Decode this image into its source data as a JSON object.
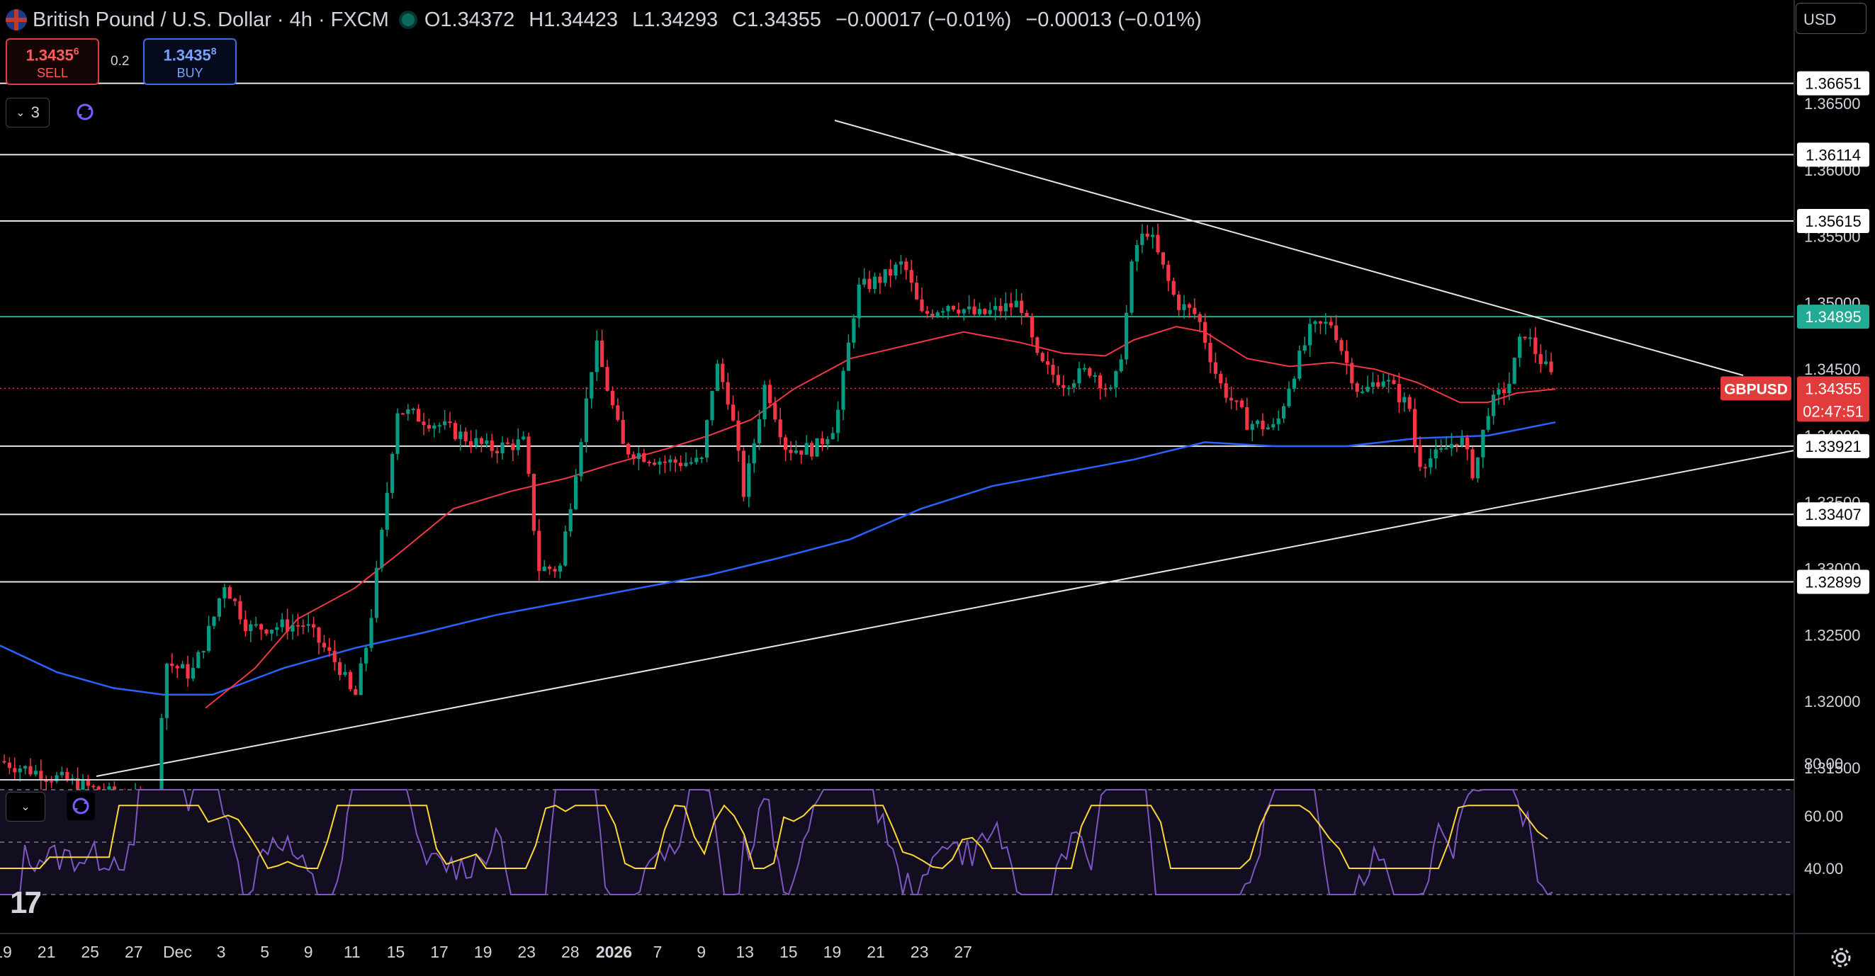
{
  "header": {
    "title": "British Pound / U.S. Dollar · 4h · FXCM",
    "ohlc": {
      "o_label": "O",
      "o": "1.34372",
      "h_label": "H",
      "h": "1.34423",
      "l_label": "L",
      "l": "1.34293",
      "c_label": "C",
      "c": "1.34355",
      "change": "−0.00017 (−0.01%)",
      "change2": "−0.00013 (−0.01%)"
    }
  },
  "trade": {
    "sell_price": "1.3435",
    "sell_sup": "6",
    "sell_label": "SELL",
    "spread": "0.2",
    "buy_price": "1.3435",
    "buy_sup": "8",
    "buy_label": "BUY"
  },
  "indicators_toggle": {
    "count": "3"
  },
  "currency_selector": "USD",
  "price_axis": {
    "ticks": [
      "1.36500",
      "1.36000",
      "1.35500",
      "1.35000",
      "1.34500",
      "1.34000",
      "1.33500",
      "1.33000",
      "1.32500",
      "1.32000",
      "1.31500"
    ]
  },
  "horizontal_levels": [
    {
      "label": "1.36651",
      "value": 1.36651
    },
    {
      "label": "1.36114",
      "value": 1.36114
    },
    {
      "label": "1.35615",
      "value": 1.35615
    },
    {
      "label": "1.34895",
      "value": 1.34895,
      "color": "#22ab94"
    },
    {
      "label": "1.33921",
      "value": 1.33921
    },
    {
      "label": "1.33407",
      "value": 1.33407
    },
    {
      "label": "1.32899",
      "value": 1.32899
    }
  ],
  "current_price": {
    "symbol": "GBPUSD",
    "value": 1.34355,
    "label": "1.34355",
    "countdown": "02:47:51",
    "color": "#e23b3b"
  },
  "rsi_axis": {
    "ticks": [
      "80.00",
      "60.00",
      "40.00"
    ]
  },
  "time_axis": {
    "labels": [
      "19",
      "21",
      "25",
      "27",
      "Dec",
      "3",
      "5",
      "9",
      "11",
      "15",
      "17",
      "19",
      "23",
      "28",
      "2026",
      "7",
      "9",
      "13",
      "15",
      "19",
      "21",
      "23",
      "27"
    ]
  },
  "colors": {
    "up": "#089981",
    "down": "#f23645",
    "ema_short": "#f23645",
    "ema_long": "#2962ff",
    "rsi_line": "#7e57c2",
    "rsi_ma": "#fdd835",
    "level_line": "#e6e6e6",
    "rsi_band_bg": "#120d1f"
  }
}
